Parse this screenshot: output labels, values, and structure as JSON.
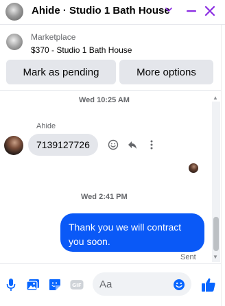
{
  "header": {
    "title": "Ahide · Studio 1 Bath House",
    "accent_color": "#8a2be2",
    "avatar_icon": "product-photo-avatar",
    "dropdown_icon": "chevron-down-icon",
    "minimize_icon": "minimize-icon",
    "close_icon": "close-icon"
  },
  "marketplace": {
    "label": "Marketplace",
    "item": "$370 - Studio 1 Bath House",
    "pending_button": "Mark as pending",
    "more_button": "More options"
  },
  "thread": {
    "timestamp_1": "Wed 10:25 AM",
    "sender_name": "Ahide",
    "incoming_message": "7139127726",
    "timestamp_2": "Wed 2:41 PM",
    "outgoing_message": "Thank you we will contract you soon.",
    "status": "Sent",
    "outgoing_color": "#0a59f7"
  },
  "composer": {
    "placeholder": "Aa",
    "icons": [
      "microphone-icon",
      "photo-icon",
      "sticker-icon",
      "gif-icon",
      "emoji-icon",
      "thumbs-up-icon"
    ],
    "accent_color": "#0866ff"
  }
}
